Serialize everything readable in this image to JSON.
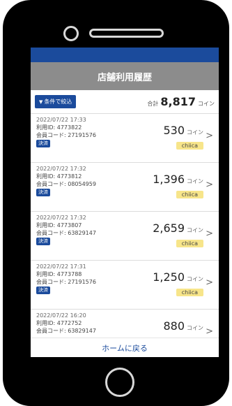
{
  "screen": {
    "title": "店舗利用履歴"
  },
  "filter": {
    "icon": "filter-icon",
    "label": "条件で絞込"
  },
  "total": {
    "label": "合計",
    "value": "8,817",
    "unit": "コイン"
  },
  "items": [
    {
      "datetime": "2022/07/22 17:33",
      "usage_id": "利用ID: 4773822",
      "member_code": "会員コード: 27191576",
      "type": "決済",
      "amount": "530",
      "unit": "コイン",
      "brand": "chiica"
    },
    {
      "datetime": "2022/07/22 17:32",
      "usage_id": "利用ID: 4773812",
      "member_code": "会員コード: 08054959",
      "type": "決済",
      "amount": "1,396",
      "unit": "コイン",
      "brand": "chiica"
    },
    {
      "datetime": "2022/07/22 17:32",
      "usage_id": "利用ID: 4773807",
      "member_code": "会員コード: 63829147",
      "type": "決済",
      "amount": "2,659",
      "unit": "コイン",
      "brand": "chiica"
    },
    {
      "datetime": "2022/07/22 17:31",
      "usage_id": "利用ID: 4773788",
      "member_code": "会員コード: 27191576",
      "type": "決済",
      "amount": "1,250",
      "unit": "コイン",
      "brand": "chiica"
    },
    {
      "datetime": "2022/07/22 16:20",
      "usage_id": "利用ID: 4772752",
      "member_code": "会員コード: 63829147",
      "type": "",
      "amount": "880",
      "unit": "コイン",
      "brand": ""
    }
  ],
  "footer": {
    "home_link": "ホームに戻る"
  },
  "colors": {
    "brand_blue": "#1b4b9c",
    "header_gray": "#8c8c8c",
    "badge_yellow": "#f7e58a"
  }
}
